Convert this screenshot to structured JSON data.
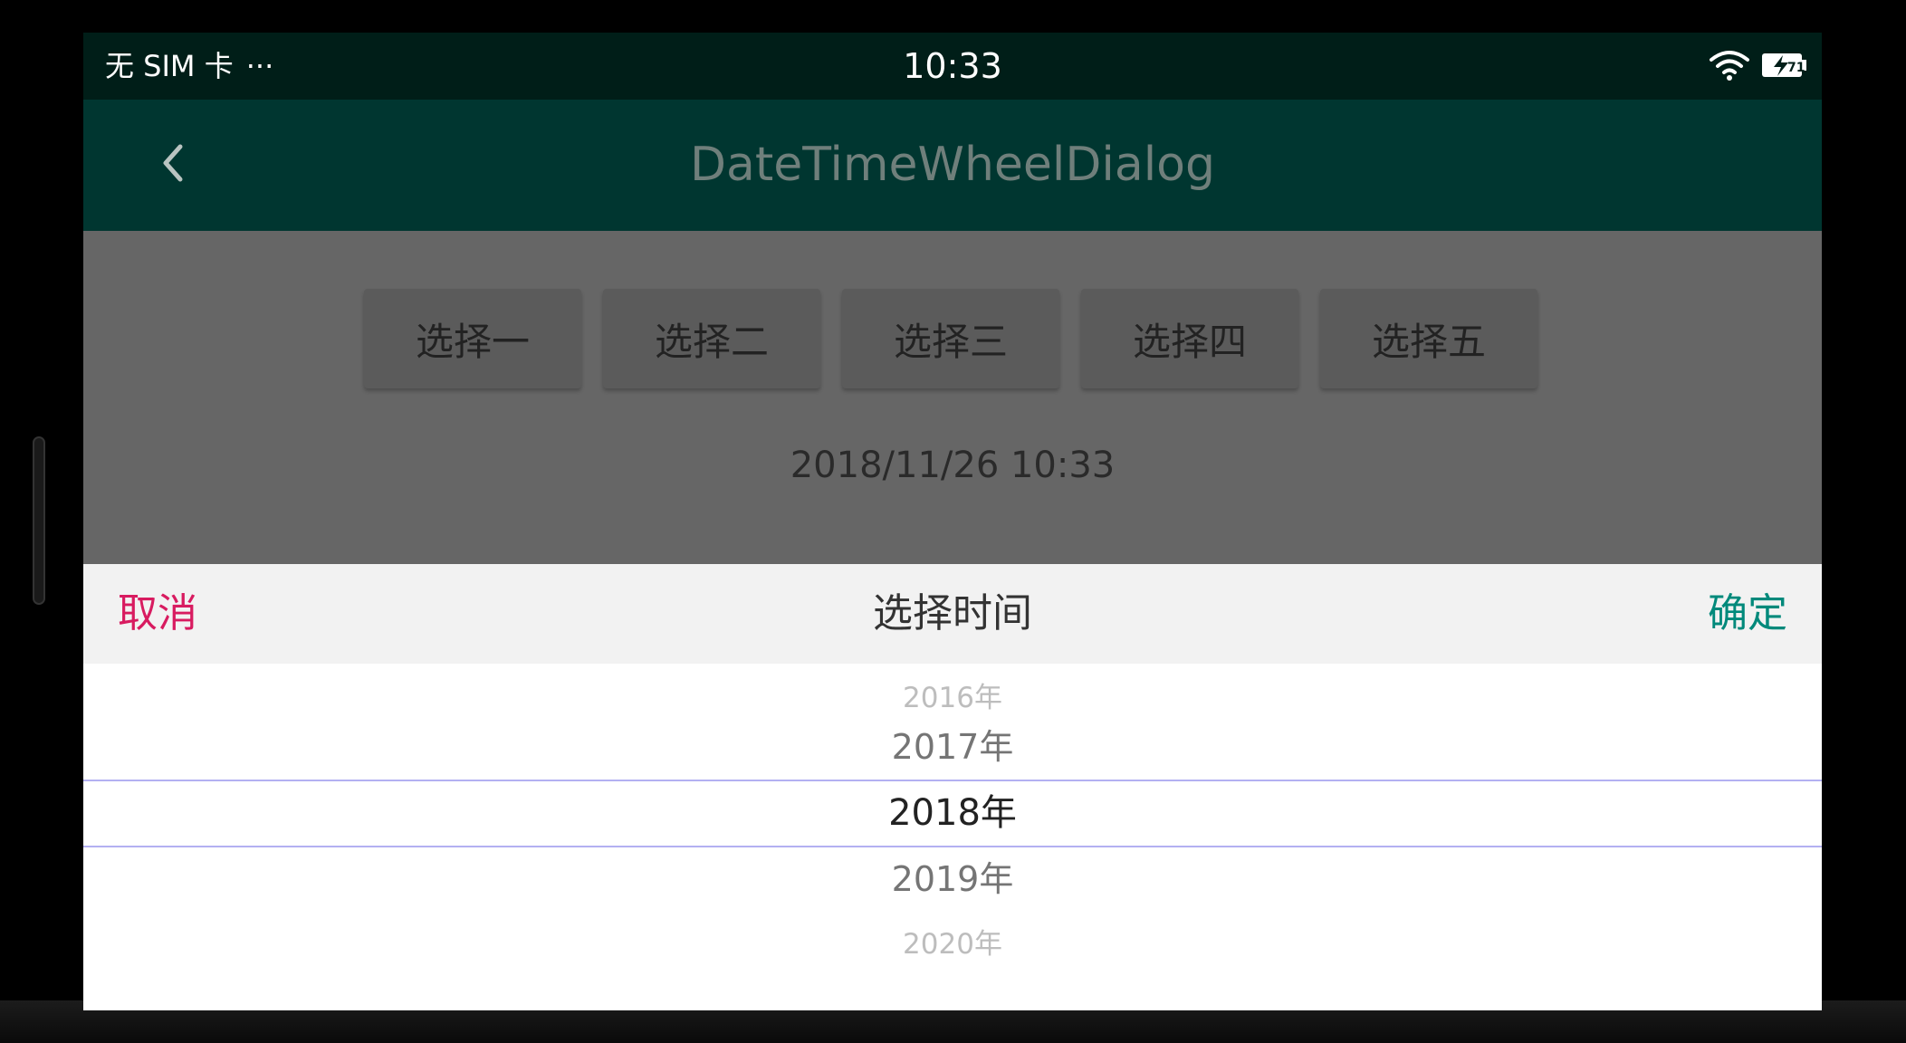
{
  "status_bar": {
    "carrier": "无 SIM 卡",
    "more": "···",
    "time": "10:33"
  },
  "toolbar": {
    "title": "DateTimeWheelDialog"
  },
  "content": {
    "buttons": [
      "选择一",
      "选择二",
      "选择三",
      "选择四",
      "选择五"
    ],
    "result": "2018/11/26 10:33"
  },
  "dialog": {
    "cancel": "取消",
    "title": "选择时间",
    "confirm": "确定",
    "wheel": {
      "items": [
        "2016年",
        "2017年",
        "2018年",
        "2019年",
        "2020年"
      ],
      "selected": "2018年"
    }
  },
  "colors": {
    "status_bar": "#001e18",
    "toolbar": "#003630",
    "cancel": "#d81b60",
    "confirm": "#00897b",
    "divider": "#b3b0f2"
  },
  "icons": {
    "back": "chevron-left-icon",
    "wifi": "wifi-icon",
    "battery": "battery-charging-icon"
  }
}
